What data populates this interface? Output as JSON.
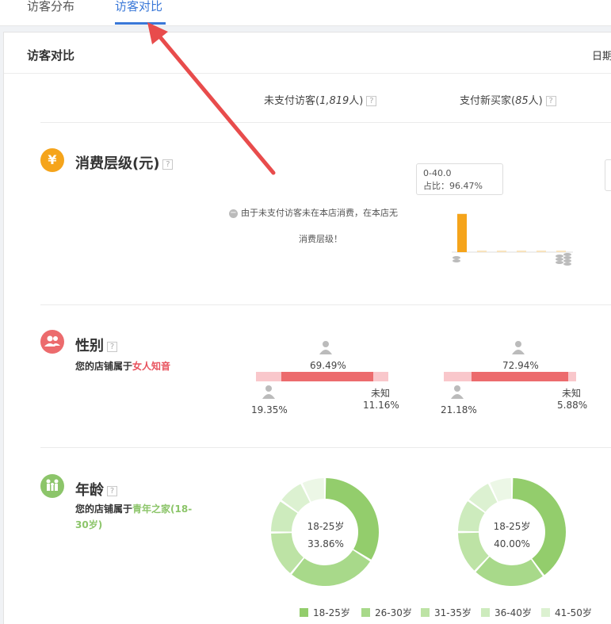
{
  "tabs": [
    {
      "label": "访客分布"
    },
    {
      "label": "访客对比"
    }
  ],
  "panel": {
    "title": "访客对比",
    "date_label": "日期"
  },
  "columns": {
    "unpaid_label": "未支付访客(",
    "unpaid_count": "1,819",
    "unpaid_unit": "人)",
    "paid_label": "支付新买家(",
    "paid_count": "85",
    "paid_unit": "人)",
    "help": "?"
  },
  "consumption": {
    "title": "消费层级(元)",
    "icon_glyph": "¥",
    "notice_line1": "由于未支付访客未在本店消费，在本店无",
    "notice_line2": "消费层级！",
    "tooltip_range": "0-40.0",
    "tooltip_share": "占比：96.47%",
    "bars": [
      96.47,
      1.2,
      0.8,
      0.6,
      0.5,
      0.43
    ]
  },
  "gender": {
    "title": "性别",
    "subtitle_prefix": "您的店铺属于",
    "subtitle_highlight": "女人知音",
    "unpaid": {
      "female": "69.49%",
      "male": "19.35%",
      "unknown_label": "未知",
      "unknown": "11.16%",
      "female_value": 69.49,
      "male_value": 19.35
    },
    "paid": {
      "female": "72.94%",
      "male": "21.18%",
      "unknown_label": "未知",
      "unknown": "5.88%",
      "female_value": 72.94,
      "male_value": 21.18
    }
  },
  "age": {
    "title": "年龄",
    "subtitle_prefix": "您的店铺属于",
    "subtitle_highlight": "青年之家(18-30岁)",
    "unpaid_center_label": "18-25岁",
    "unpaid_center_value": "33.86%",
    "paid_center_label": "18-25岁",
    "paid_center_value": "40.00%",
    "unpaid_slices": [
      33.86,
      27,
      14,
      10,
      8,
      7.14
    ],
    "paid_slices": [
      40.0,
      22,
      13,
      10,
      8,
      7
    ],
    "legend": [
      "18-25岁",
      "26-30岁",
      "31-35岁",
      "36-40岁",
      "41-50岁"
    ]
  },
  "colors": {
    "accent": "#3a78d8",
    "orange": "#f5a41b",
    "red": "#ec6b6d",
    "pink": "#f9c7cb",
    "green1": "#93cd6c",
    "green2": "#a8d98a",
    "green3": "#bde3a5",
    "green4": "#cdebbd",
    "green5": "#dcf1d1",
    "green6": "#ecf7e6"
  }
}
